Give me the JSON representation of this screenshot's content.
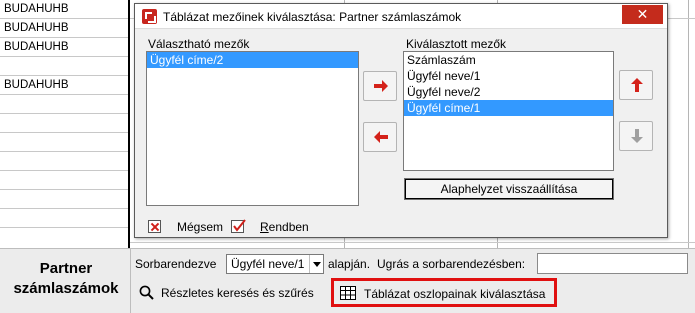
{
  "background": {
    "rows": [
      {
        "text": "BUDAHUHB"
      },
      {
        "text": "BUDAHUHB"
      },
      {
        "text": "BUDAHUHB"
      },
      {
        "text": ""
      },
      {
        "text": "BUDAHUHB"
      },
      {
        "text": ""
      },
      {
        "text": ""
      },
      {
        "text": ""
      },
      {
        "text": ""
      },
      {
        "text": ""
      },
      {
        "text": ""
      },
      {
        "text": ""
      }
    ]
  },
  "dialog": {
    "title": "Táblázat mezőinek kiválasztása: Partner számlaszámok",
    "close_icon": "close-icon",
    "available_label": "Választható mezők",
    "available_items": [
      "Ügyfél címe/2"
    ],
    "available_selected_index": 0,
    "selected_label": "Kiválasztott mezők",
    "selected_items": [
      "Számlaszám",
      "Ügyfél neve/1",
      "Ügyfél neve/2",
      "Ügyfél címe/1"
    ],
    "selected_selected_index": 3,
    "reset_label": "Alaphelyzet visszaállítása",
    "cancel_prefix": "Mé",
    "cancel_underlined": "g",
    "cancel_suffix": "sem",
    "ok_underlined": "R",
    "ok_suffix": "endben",
    "colors": {
      "arrow": "#d4221a",
      "arrow_disabled": "#a0a0a0",
      "selection": "#3399ff"
    }
  },
  "panel": {
    "section_title_line1": "Partner",
    "section_title_line2": "számlaszámok",
    "sort_prefix": "Sorbarendezve",
    "sort_value": "Ügyfél neve/1",
    "sort_suffix": "alapján.",
    "jump_label": "Ugrás a sorbarendezésben:",
    "jump_value": "",
    "search_button": "Részletes keresés és szűrés",
    "columns_button": "Táblázat oszlopainak kiválasztása",
    "highlight_color": "#e01010"
  }
}
